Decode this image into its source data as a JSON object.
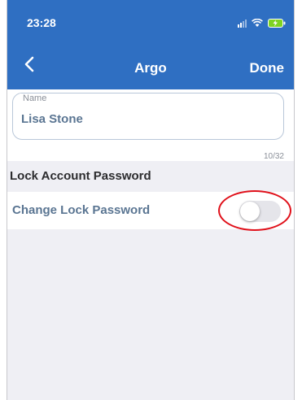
{
  "status_bar": {
    "time": "23:28",
    "icons": [
      "signal-icon",
      "wifi-icon",
      "battery-charging-icon"
    ]
  },
  "nav": {
    "title": "Argo",
    "done_label": "Done",
    "back_icon": "chevron-left-icon"
  },
  "name_field": {
    "label": "Name",
    "value": "Lisa Stone",
    "counter": "10/32"
  },
  "lock_section": {
    "header": "Lock Account Password",
    "change_label": "Change Lock Password",
    "toggle_on": false
  },
  "colors": {
    "nav_blue": "#2f6fc2",
    "label_blue": "#5a7592",
    "annotation_red": "#e0101a",
    "background_gray": "#efeff4"
  }
}
